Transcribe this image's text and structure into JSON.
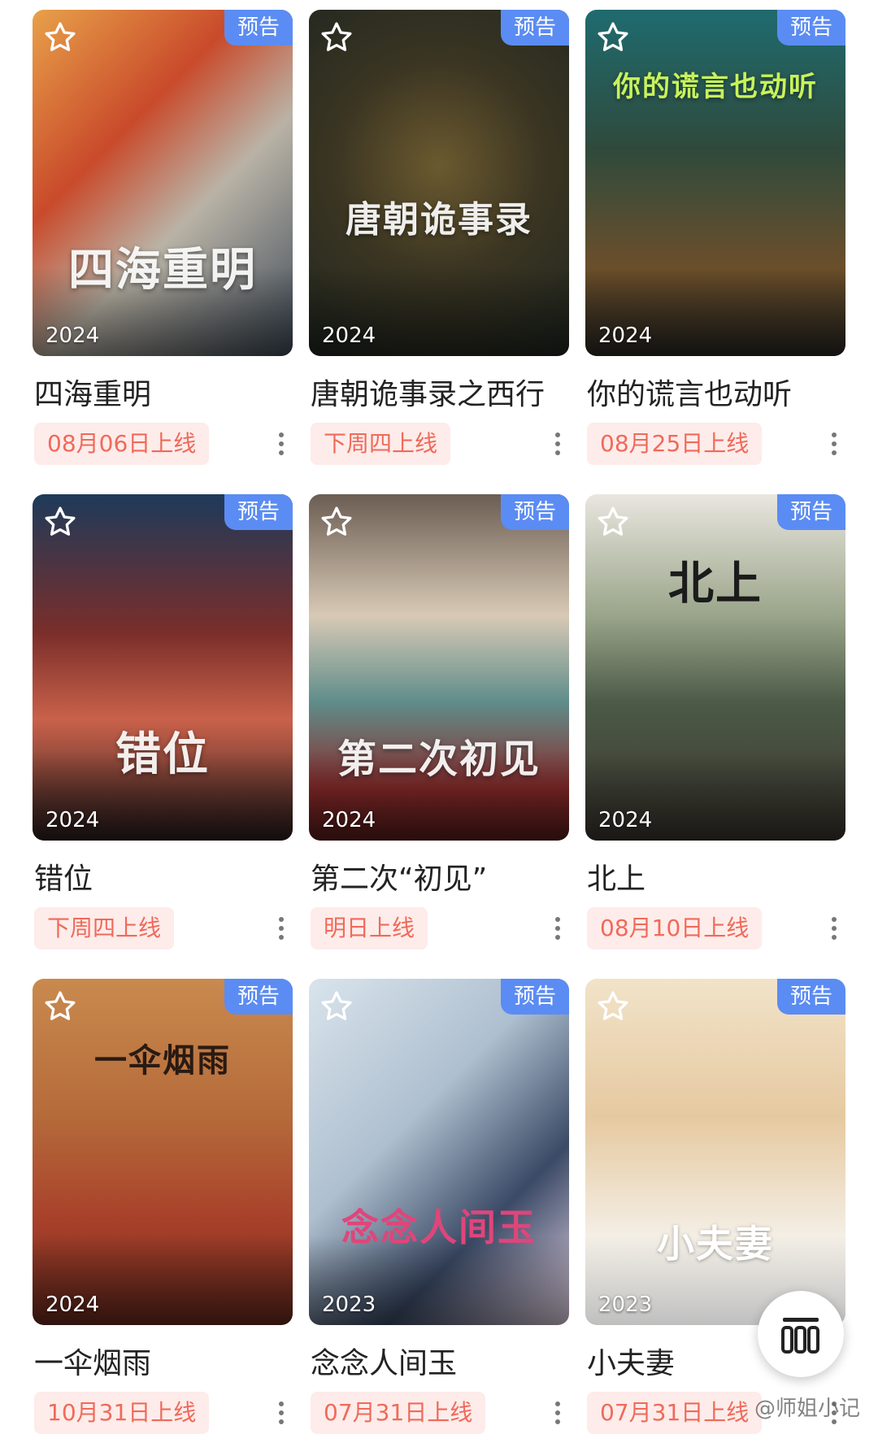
{
  "grid": [
    {
      "title": "四海重明",
      "release": "08月06日上线",
      "year": "2024",
      "badge": "预告",
      "poster_text": "四海重明",
      "icons": {
        "favorite": "star-outline-icon",
        "more": "more-vertical-icon"
      }
    },
    {
      "title": "唐朝诡事录之西行",
      "release": "下周四上线",
      "year": "2024",
      "badge": "预告",
      "poster_text": "唐朝诡事录",
      "icons": {
        "favorite": "star-outline-icon",
        "more": "more-vertical-icon"
      }
    },
    {
      "title": "你的谎言也动听",
      "release": "08月25日上线",
      "year": "2024",
      "badge": "预告",
      "poster_text": "你的谎言也动听",
      "icons": {
        "favorite": "star-outline-icon",
        "more": "more-vertical-icon"
      }
    },
    {
      "title": "错位",
      "release": "下周四上线",
      "year": "2024",
      "badge": "预告",
      "poster_text": "错位",
      "icons": {
        "favorite": "star-outline-icon",
        "more": "more-vertical-icon"
      }
    },
    {
      "title": "第二次“初见”",
      "release": "明日上线",
      "year": "2024",
      "badge": "预告",
      "poster_text": "第二次初见",
      "icons": {
        "favorite": "star-outline-icon",
        "more": "more-vertical-icon"
      }
    },
    {
      "title": "北上",
      "release": "08月10日上线",
      "year": "2024",
      "badge": "预告",
      "poster_text": "北上",
      "icons": {
        "favorite": "star-outline-icon",
        "more": "more-vertical-icon"
      }
    },
    {
      "title": "一伞烟雨",
      "release": "10月31日上线",
      "year": "2024",
      "badge": "预告",
      "poster_text": "一伞烟雨",
      "icons": {
        "favorite": "star-outline-icon",
        "more": "more-vertical-icon"
      }
    },
    {
      "title": "念念人间玉",
      "release": "07月31日上线",
      "year": "2023",
      "badge": "预告",
      "poster_text": "念念人间玉",
      "icons": {
        "favorite": "star-outline-icon",
        "more": "more-vertical-icon"
      }
    },
    {
      "title": "小夫妻",
      "release": "07月31日上线",
      "year": "2023",
      "badge": "预告",
      "poster_text": "小夫妻",
      "icons": {
        "favorite": "star-outline-icon",
        "more": "more-vertical-icon"
      }
    }
  ],
  "floating_action": {
    "icon": "grid-view-icon"
  },
  "watermark": "@师姐小记",
  "colors": {
    "badge": "#5b8cf3",
    "pill_bg": "#fdecea",
    "pill_text": "#f06a5a",
    "title_text": "#222222"
  }
}
